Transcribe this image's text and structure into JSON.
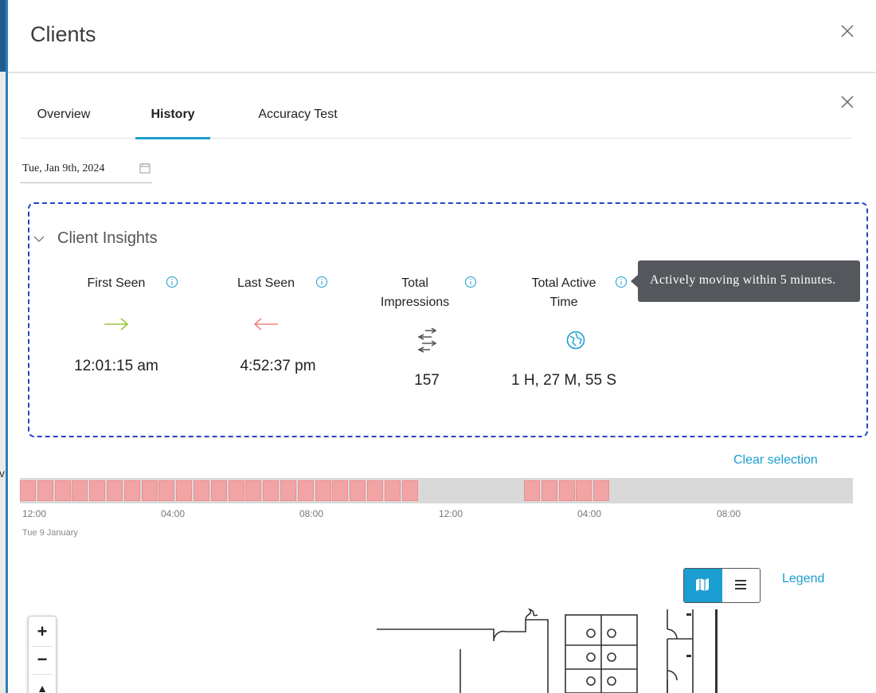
{
  "header": {
    "title": "Clients"
  },
  "tabs": [
    {
      "label": "Overview",
      "active": false
    },
    {
      "label": "History",
      "active": true
    },
    {
      "label": "Accuracy Test",
      "active": false
    }
  ],
  "date_picker": {
    "value": "Tue, Jan 9th, 2024",
    "icon": "calendar-icon"
  },
  "insights": {
    "title": "Client Insights",
    "metrics": [
      {
        "label": "First Seen",
        "value": "12:01:15 am",
        "icon": "arrow-right-icon",
        "icon_color": "#9cc43a"
      },
      {
        "label": "Last Seen",
        "value": "4:52:37 pm",
        "icon": "arrow-left-icon",
        "icon_color": "#f08080"
      },
      {
        "label": "Total Impressions",
        "value": "157",
        "icon": "impressions-arrows-icon",
        "icon_color": "#555555"
      },
      {
        "label": "Total Active Time",
        "value": "1 H, 27 M, 55 S",
        "icon": "globe-icon",
        "icon_color": "#1a9dd0"
      }
    ],
    "tooltip": "Actively moving within 5 minutes."
  },
  "timeline": {
    "clear_selection": "Clear selection",
    "ticks": [
      "12:00",
      "04:00",
      "08:00",
      "12:00",
      "04:00",
      "08:00"
    ],
    "date_caption": "Tue 9 January",
    "segment_color": "#f2a3a3"
  },
  "map_controls": {
    "legend": "Legend",
    "view_active": "map",
    "zoom_in": "+",
    "zoom_out": "−"
  },
  "colors": {
    "accent": "#1a9dd0",
    "dashed_border": "#2541c8",
    "tooltip_bg": "#54575c"
  }
}
